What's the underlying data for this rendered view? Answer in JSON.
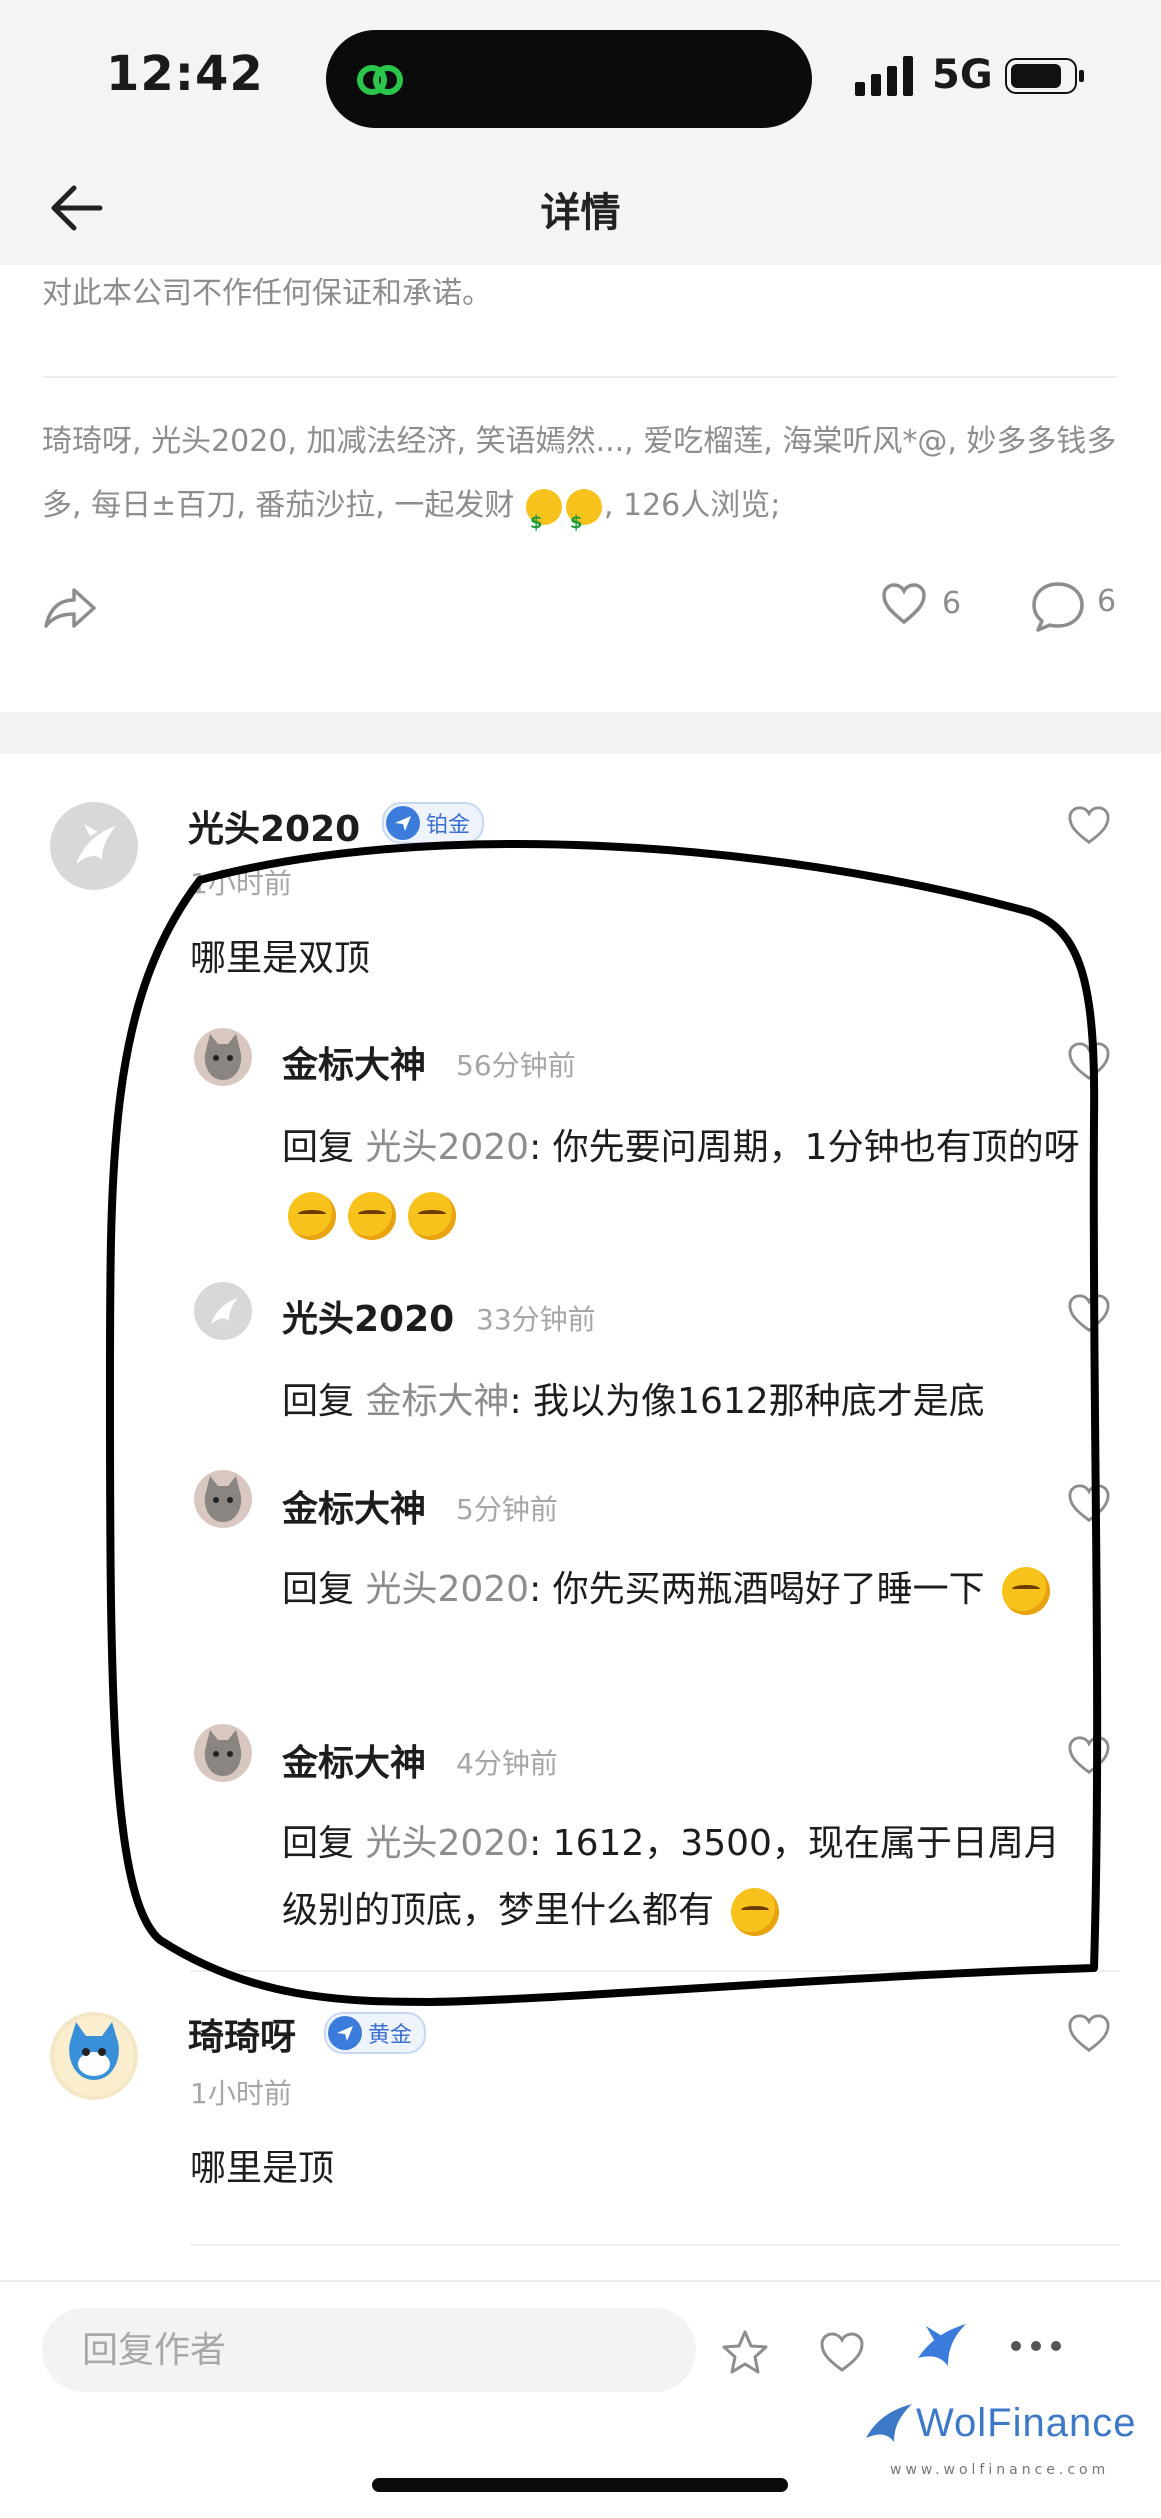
{
  "status_bar": {
    "time": "12:42",
    "network": "5G"
  },
  "nav": {
    "title": "详情"
  },
  "post": {
    "disclaimer_partial": "对此本公司不作任何保证和承诺。",
    "viewers_text": "琦琦呀, 光头2020, 加减法经济, 笑语嫣然..., 爱吃榴莲, 海棠听风*@, 妙多多钱多多, 每日±百刀, 番茄沙拉, 一起发财",
    "views_suffix": ", 126人浏览;",
    "like_count": "6",
    "comment_count": "6"
  },
  "comments": [
    {
      "username": "光头2020",
      "badge": "铂金",
      "time": "1小时前",
      "text": "哪里是双顶",
      "replies": [
        {
          "username": "金标大神",
          "time": "56分钟前",
          "reply_word": "回复",
          "to": "光头2020",
          "text": ": 你先要问周期，1分钟也有顶的呀"
        },
        {
          "username": "光头2020",
          "time": "33分钟前",
          "reply_word": "回复",
          "to": "金标大神",
          "text": ": 我以为像1612那种底才是底"
        },
        {
          "username": "金标大神",
          "time": "5分钟前",
          "reply_word": "回复",
          "to": "光头2020",
          "text": ": 你先买两瓶酒喝好了睡一下"
        },
        {
          "username": "金标大神",
          "time": "4分钟前",
          "reply_word": "回复",
          "to": "光头2020",
          "text": ": 1612，3500，现在属于日周月级别的顶底，梦里什么都有"
        }
      ]
    },
    {
      "username": "琦琦呀",
      "badge": "黄金",
      "time": "1小时前",
      "text": "哪里是顶"
    }
  ],
  "bottom_bar": {
    "reply_placeholder": "回复作者"
  },
  "watermark": {
    "brand": "WolFinance",
    "url": "www.wolfinance.com"
  },
  "colors": {
    "accent_blue": "#3b7bdb",
    "annotation": "#000000",
    "gray_text": "#8d8d8d"
  }
}
